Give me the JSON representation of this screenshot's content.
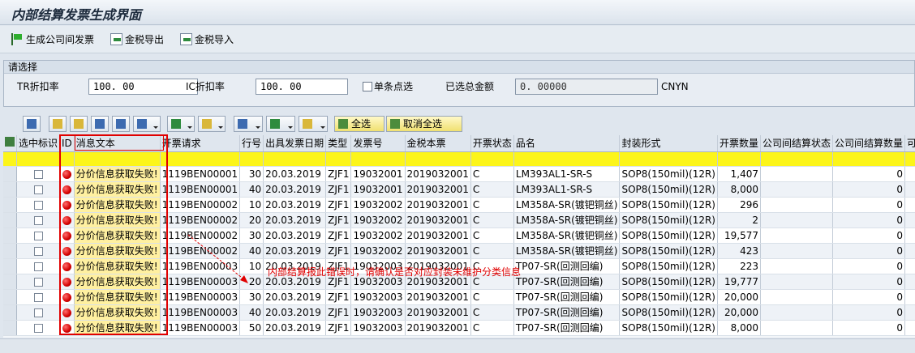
{
  "window": {
    "title": "内部结算发票生成界面"
  },
  "toolbar": {
    "buttons": [
      {
        "label": "生成公司间发票",
        "icon": "flag-icon"
      },
      {
        "label": "金税导出",
        "icon": "export-icon"
      },
      {
        "label": "金税导入",
        "icon": "import-icon"
      }
    ]
  },
  "selection": {
    "title": "请选择",
    "tr_label": "TR折扣率",
    "tr_value": "100. 00",
    "ic_label": "IC折扣率",
    "ic_value": "100. 00",
    "single_label": "单条点选",
    "total_label": "已选总金额",
    "total_value": "0. 00000",
    "currency": "CNYN"
  },
  "grid_toolbar": {
    "select_all": "全选",
    "deselect_all": "取消全选"
  },
  "grid": {
    "headers": [
      "选中标识",
      "ID",
      "消息文本",
      "开票请求",
      "行号",
      "出具发票日期",
      "类型",
      "发票号",
      "金税本票",
      "开票状态",
      "品名",
      "封装形式",
      "开票数量",
      "公司间结算状态",
      "公司间结算数量",
      "可"
    ],
    "rows": [
      [
        "分价信息获取失败!",
        "1119BEN00001",
        "30",
        "20.03.2019",
        "ZJF1",
        "19032001",
        "2019032001",
        "C",
        "LM393AL1-SR-S",
        "SOP8(150mil)(12R)",
        "1,407",
        "",
        "0"
      ],
      [
        "分价信息获取失败!",
        "1119BEN00001",
        "40",
        "20.03.2019",
        "ZJF1",
        "19032001",
        "2019032001",
        "C",
        "LM393AL1-SR-S",
        "SOP8(150mil)(12R)",
        "8,000",
        "",
        "0"
      ],
      [
        "分价信息获取失败!",
        "1119BEN00002",
        "10",
        "20.03.2019",
        "ZJF1",
        "19032002",
        "2019032001",
        "C",
        "LM358A-SR(镀钯铜丝)",
        "SOP8(150mil)(12R)",
        "296",
        "",
        "0"
      ],
      [
        "分价信息获取失败!",
        "1119BEN00002",
        "20",
        "20.03.2019",
        "ZJF1",
        "19032002",
        "2019032001",
        "C",
        "LM358A-SR(镀钯铜丝)",
        "SOP8(150mil)(12R)",
        "2",
        "",
        "0"
      ],
      [
        "分价信息获取失败!",
        "1119BEN00002",
        "30",
        "20.03.2019",
        "ZJF1",
        "19032002",
        "2019032001",
        "C",
        "LM358A-SR(镀钯铜丝)",
        "SOP8(150mil)(12R)",
        "19,577",
        "",
        "0"
      ],
      [
        "分价信息获取失败!",
        "1119BEN00002",
        "40",
        "20.03.2019",
        "ZJF1",
        "19032002",
        "2019032001",
        "C",
        "LM358A-SR(镀钯铜丝)",
        "SOP8(150mil)(12R)",
        "423",
        "",
        "0"
      ],
      [
        "分价信息获取失败!",
        "1119BEN00003",
        "10",
        "20.03.2019",
        "ZJF1",
        "19032003",
        "2019032001",
        "C",
        "TP07-SR(回测回编)",
        "SOP8(150mil)(12R)",
        "223",
        "",
        "0"
      ],
      [
        "分价信息获取失败!",
        "1119BEN00003",
        "20",
        "20.03.2019",
        "ZJF1",
        "19032003",
        "2019032001",
        "C",
        "TP07-SR(回测回编)",
        "SOP8(150mil)(12R)",
        "19,777",
        "",
        "0"
      ],
      [
        "分价信息获取失败!",
        "1119BEN00003",
        "30",
        "20.03.2019",
        "ZJF1",
        "19032003",
        "2019032001",
        "C",
        "TP07-SR(回测回编)",
        "SOP8(150mil)(12R)",
        "20,000",
        "",
        "0"
      ],
      [
        "分价信息获取失败!",
        "1119BEN00003",
        "40",
        "20.03.2019",
        "ZJF1",
        "19032003",
        "2019032001",
        "C",
        "TP07-SR(回测回编)",
        "SOP8(150mil)(12R)",
        "20,000",
        "",
        "0"
      ],
      [
        "分价信息获取失败!",
        "1119BEN00003",
        "50",
        "20.03.2019",
        "ZJF1",
        "19032003",
        "2019032001",
        "C",
        "TP07-SR(回测回编)",
        "SOP8(150mil)(12R)",
        "8,000",
        "",
        "0"
      ]
    ]
  },
  "annotation": {
    "text": "内部结算报此错误时，请确认是否对应封装未维护分类信息"
  },
  "colors": {
    "accent_red": "#e00000",
    "message_bg": "#fff0a0",
    "highlight_row": "#fcf51a"
  }
}
